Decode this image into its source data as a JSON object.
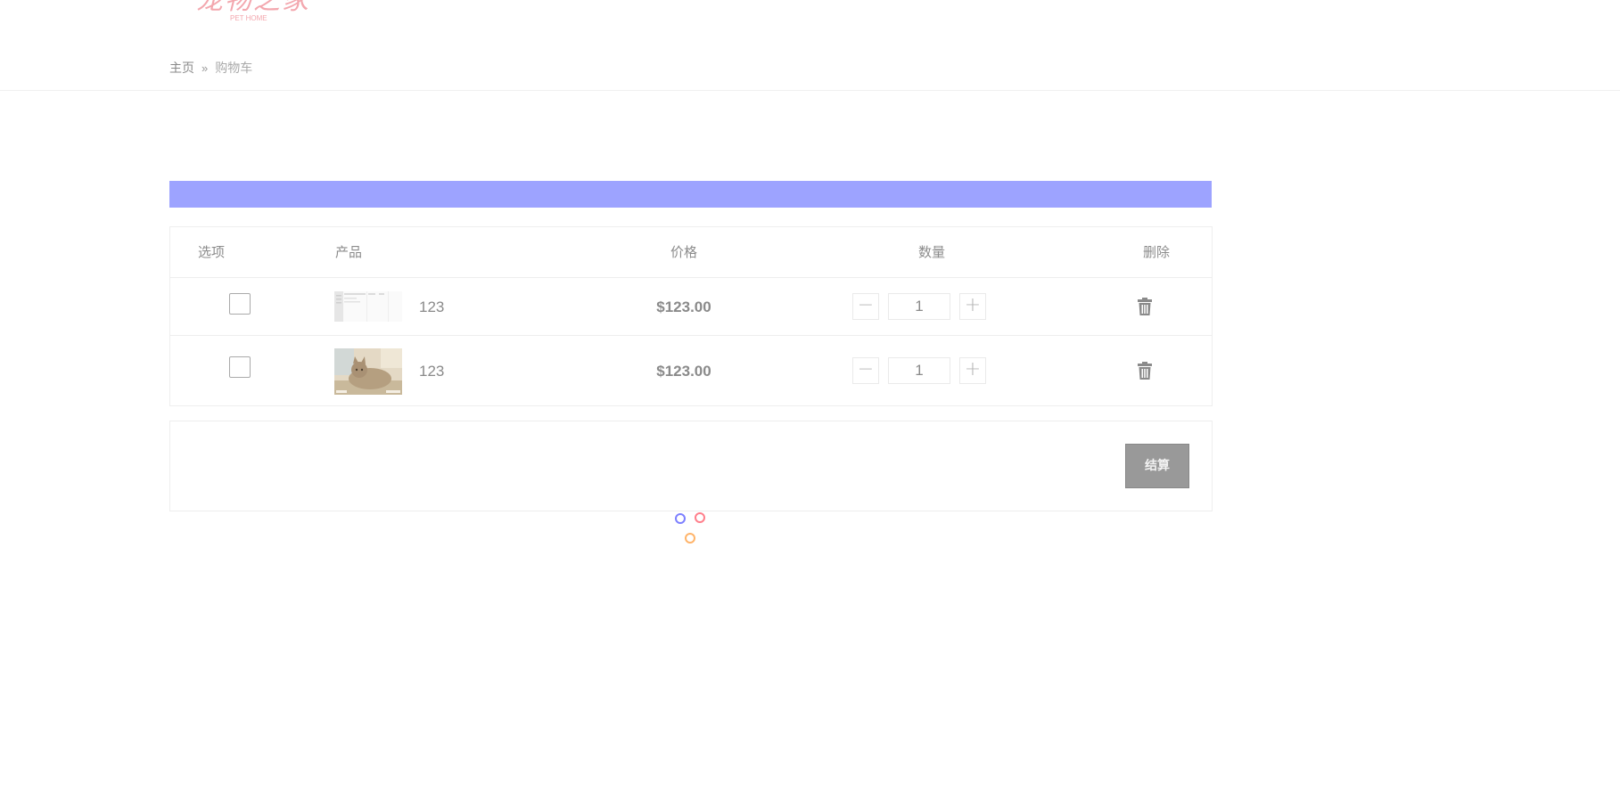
{
  "logo": {
    "text": "宠物之家",
    "subtext": "PET HOME",
    "color": "#f3a7ae"
  },
  "breadcrumb": {
    "home": "主页",
    "separator": "»",
    "current": "购物车"
  },
  "banner": {
    "color": "#9da3ff"
  },
  "cart": {
    "headers": {
      "option": "选项",
      "product": "产品",
      "price": "价格",
      "quantity": "数量",
      "delete": "删除"
    },
    "items": [
      {
        "name": "123",
        "price": "$123.00",
        "quantity": "1",
        "checked": false,
        "thumbnail": "document-screenshot"
      },
      {
        "name": "123",
        "price": "$123.00",
        "quantity": "1",
        "checked": false,
        "thumbnail": "cat-photo"
      }
    ],
    "minus_label": "−",
    "plus_label": "+",
    "delete_icon": "trash-icon"
  },
  "checkout": {
    "label": "结算",
    "color": "#999999"
  },
  "loader": {
    "colors": [
      "#7d80ff",
      "#ff7f8b",
      "#ffb46a"
    ]
  }
}
